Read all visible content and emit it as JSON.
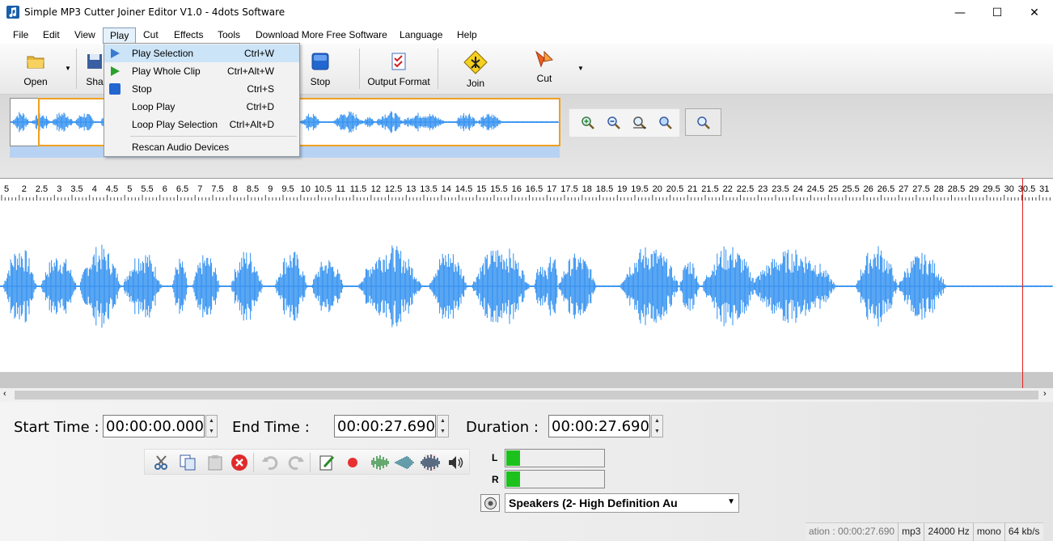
{
  "window": {
    "title": "Simple MP3 Cutter Joiner Editor V1.0 - 4dots Software",
    "minimize": "—",
    "maximize": "☐",
    "close": "✕"
  },
  "menu": [
    "File",
    "Edit",
    "View",
    "Play",
    "Cut",
    "Effects",
    "Tools",
    "Download More Free Software",
    "Language",
    "Help"
  ],
  "toolbar": {
    "open": "Open",
    "share": "Sha",
    "stop": "Stop",
    "output_format": "Output Format",
    "join": "Join",
    "cut": "Cut"
  },
  "play_menu": [
    {
      "label": "Play Selection",
      "shortcut": "Ctrl+W"
    },
    {
      "label": "Play Whole Clip",
      "shortcut": "Ctrl+Alt+W"
    },
    {
      "label": "Stop",
      "shortcut": "Ctrl+S"
    },
    {
      "label": "Loop Play",
      "shortcut": "Ctrl+D"
    },
    {
      "label": "Loop Play Selection",
      "shortcut": "Ctrl+Alt+D"
    },
    {
      "label": "Rescan Audio Devices",
      "shortcut": ""
    }
  ],
  "ruler_labels": [
    "5",
    "2",
    "2.5",
    "3",
    "3.5",
    "4",
    "4.5",
    "5",
    "5.5",
    "6",
    "6.5",
    "7",
    "7.5",
    "8",
    "8.5",
    "9",
    "9.5",
    "10",
    "10.5",
    "11",
    "11.5",
    "12",
    "12.5",
    "13",
    "13.5",
    "14",
    "14.5",
    "15",
    "15.5",
    "16",
    "16.5",
    "17",
    "17.5",
    "18",
    "18.5",
    "19",
    "19.5",
    "20",
    "20.5",
    "21",
    "21.5",
    "22",
    "22.5",
    "23",
    "23.5",
    "24",
    "24.5",
    "25",
    "25.5",
    "26",
    "26.5",
    "27",
    "27.5",
    "28",
    "28.5",
    "29",
    "29.5",
    "30",
    "30.5",
    "31"
  ],
  "times": {
    "start_label": "Start Time :",
    "start_value": "00:00:00.000",
    "end_label": "End Time :",
    "end_value": "00:00:27.690",
    "duration_label": "Duration :",
    "duration_value": "00:00:27.690"
  },
  "meters": {
    "left_label": "L",
    "right_label": "R",
    "left_level": 0.14,
    "right_level": 0.14
  },
  "device": {
    "selected": "Speakers (2- High Definition Au"
  },
  "status": {
    "duration": "ation : 00:00:27.690",
    "format": "mp3",
    "rate": "24000 Hz",
    "channels": "mono",
    "bitrate": "64 kb/s"
  },
  "colors": {
    "wave": "#2f8ff0",
    "cursor": "#e02020",
    "selection": "#f0a020",
    "meter": "#1dc11d"
  }
}
